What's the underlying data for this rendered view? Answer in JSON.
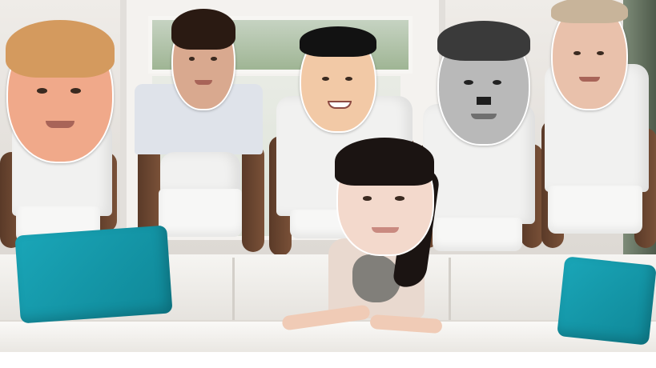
{
  "image": {
    "kind": "photo-collage-meme",
    "text": []
  },
  "colors": {
    "wall": "#e9e6e2",
    "sofa": "#f2f0ec",
    "cushion": "#1aa6b8",
    "shirt": "#f1f1f0",
    "skin_dark": "#6a4530"
  },
  "figures": [
    {
      "name": "standing-figure-1",
      "hair_color": "#d49a5e",
      "face_color": "#f0a98a"
    },
    {
      "name": "standing-figure-2",
      "hair_color": "#2a1a12",
      "face_color": "#d9a98f",
      "shirt": "light-blue-collared"
    },
    {
      "name": "standing-figure-3",
      "hair_color": "#121212",
      "face_color": "#f2c9a6"
    },
    {
      "name": "standing-figure-4",
      "hair_color": "#3a3a3a",
      "face_color": "#b9b9b9",
      "grayscale": true
    },
    {
      "name": "standing-figure-5",
      "hair_color": "#c8b49a",
      "face_color": "#e9c1ab"
    }
  ],
  "seated_figure": {
    "name": "seated-figure",
    "hair_color": "#1b1412",
    "face_color": "#f3d9cc"
  }
}
